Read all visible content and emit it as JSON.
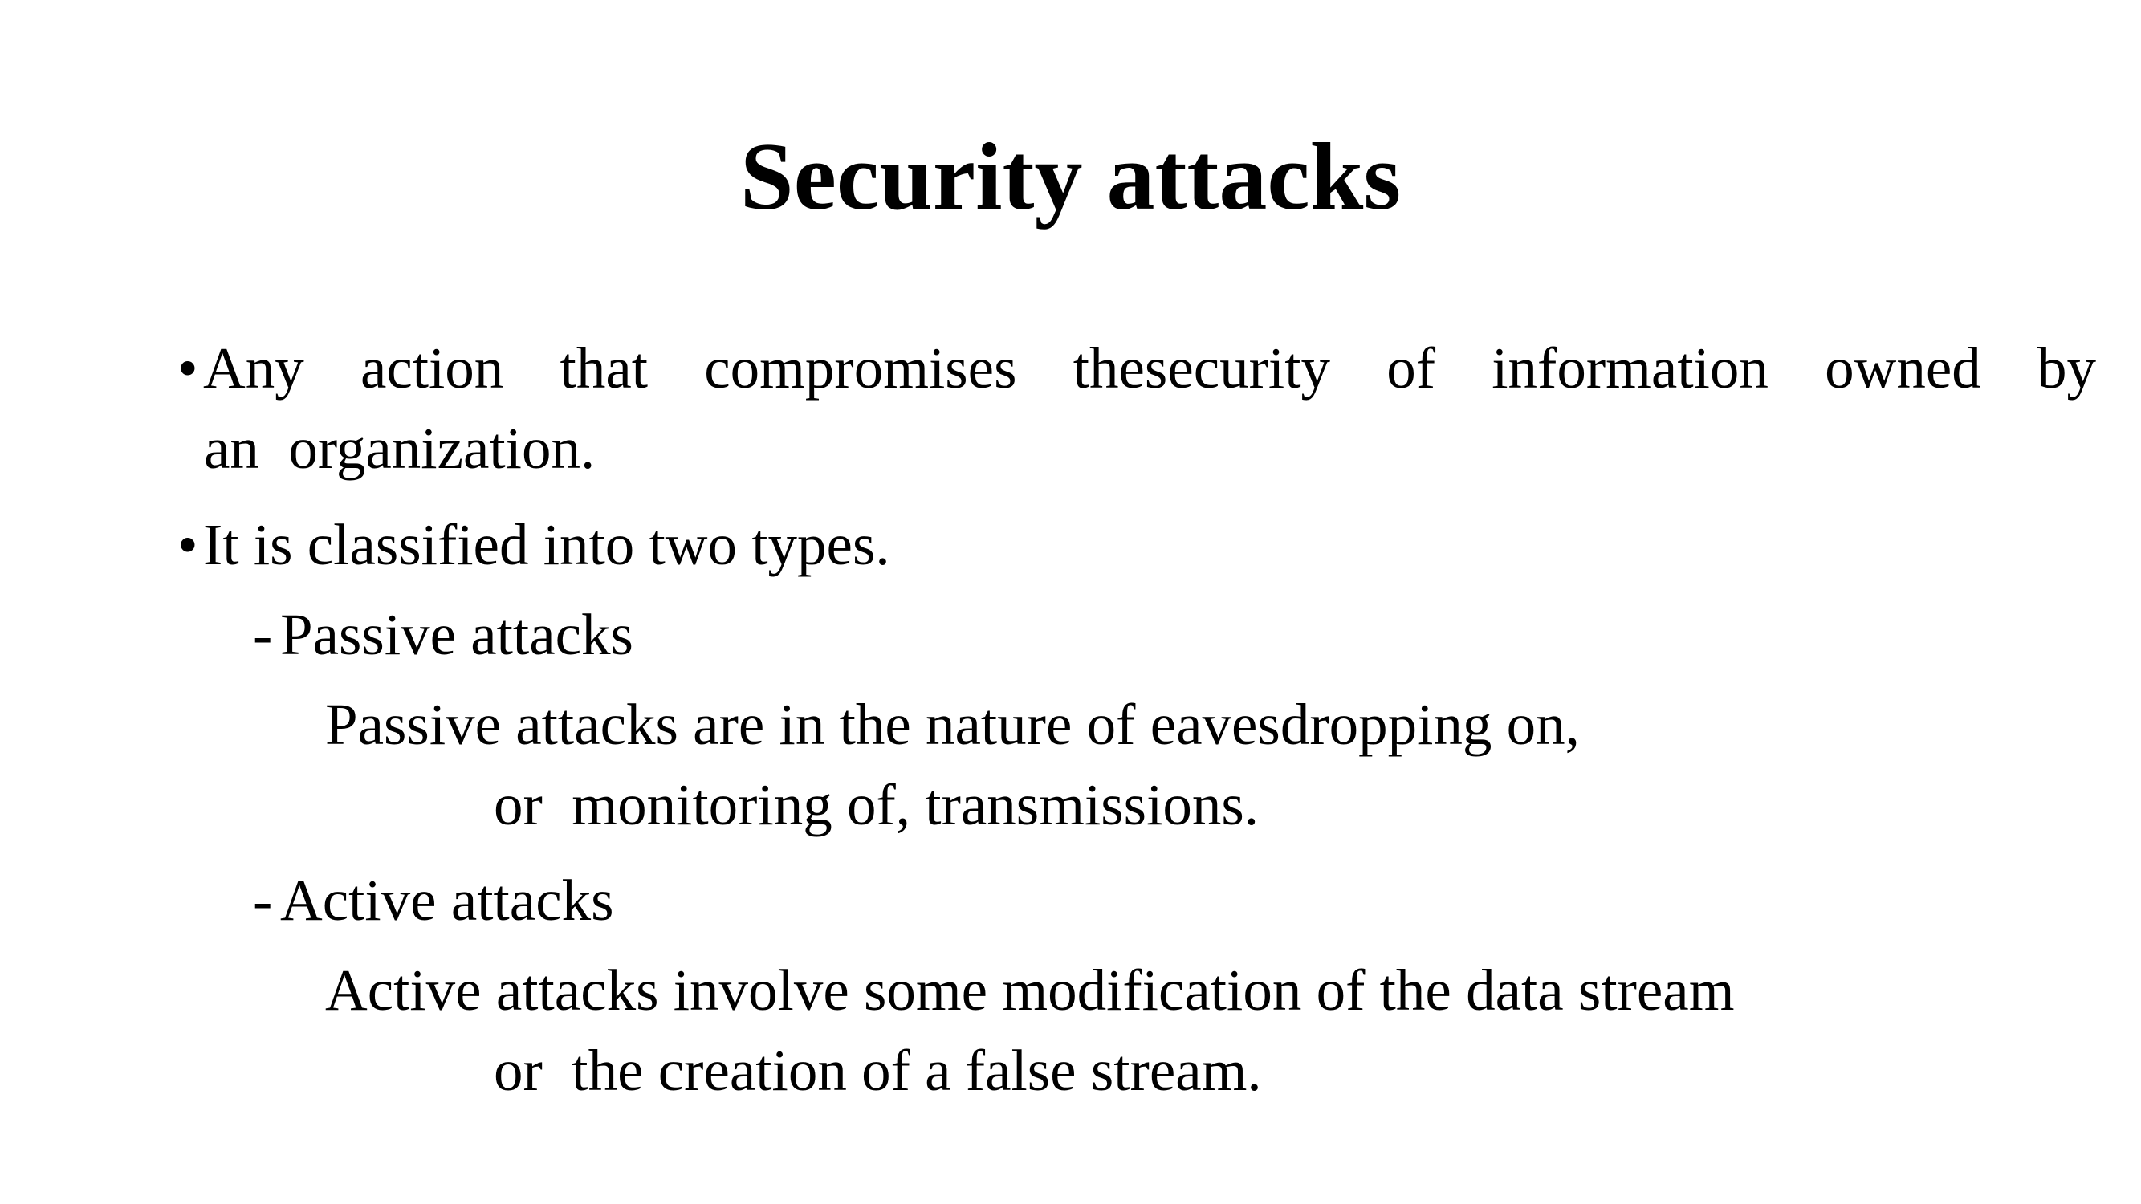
{
  "slide": {
    "title": "Security attacks",
    "bullet1": {
      "marker": "•",
      "words": [
        "Any",
        "action",
        "that",
        "compromises",
        "the",
        "security",
        "of",
        "information",
        "owned",
        "by"
      ],
      "continuation": "an  organization."
    },
    "bullet2": {
      "marker": "•",
      "text": "It is classified into two types."
    },
    "passive": {
      "dash": "-",
      "heading": "Passive attacks",
      "line1": "Passive attacks are in the nature of eavesdropping on,",
      "line2": "or  monitoring of, transmissions."
    },
    "active": {
      "dash": "-",
      "heading": "Active attacks",
      "line1": "Active attacks involve some modification of the data stream",
      "line2": "or  the creation of a false stream."
    }
  }
}
